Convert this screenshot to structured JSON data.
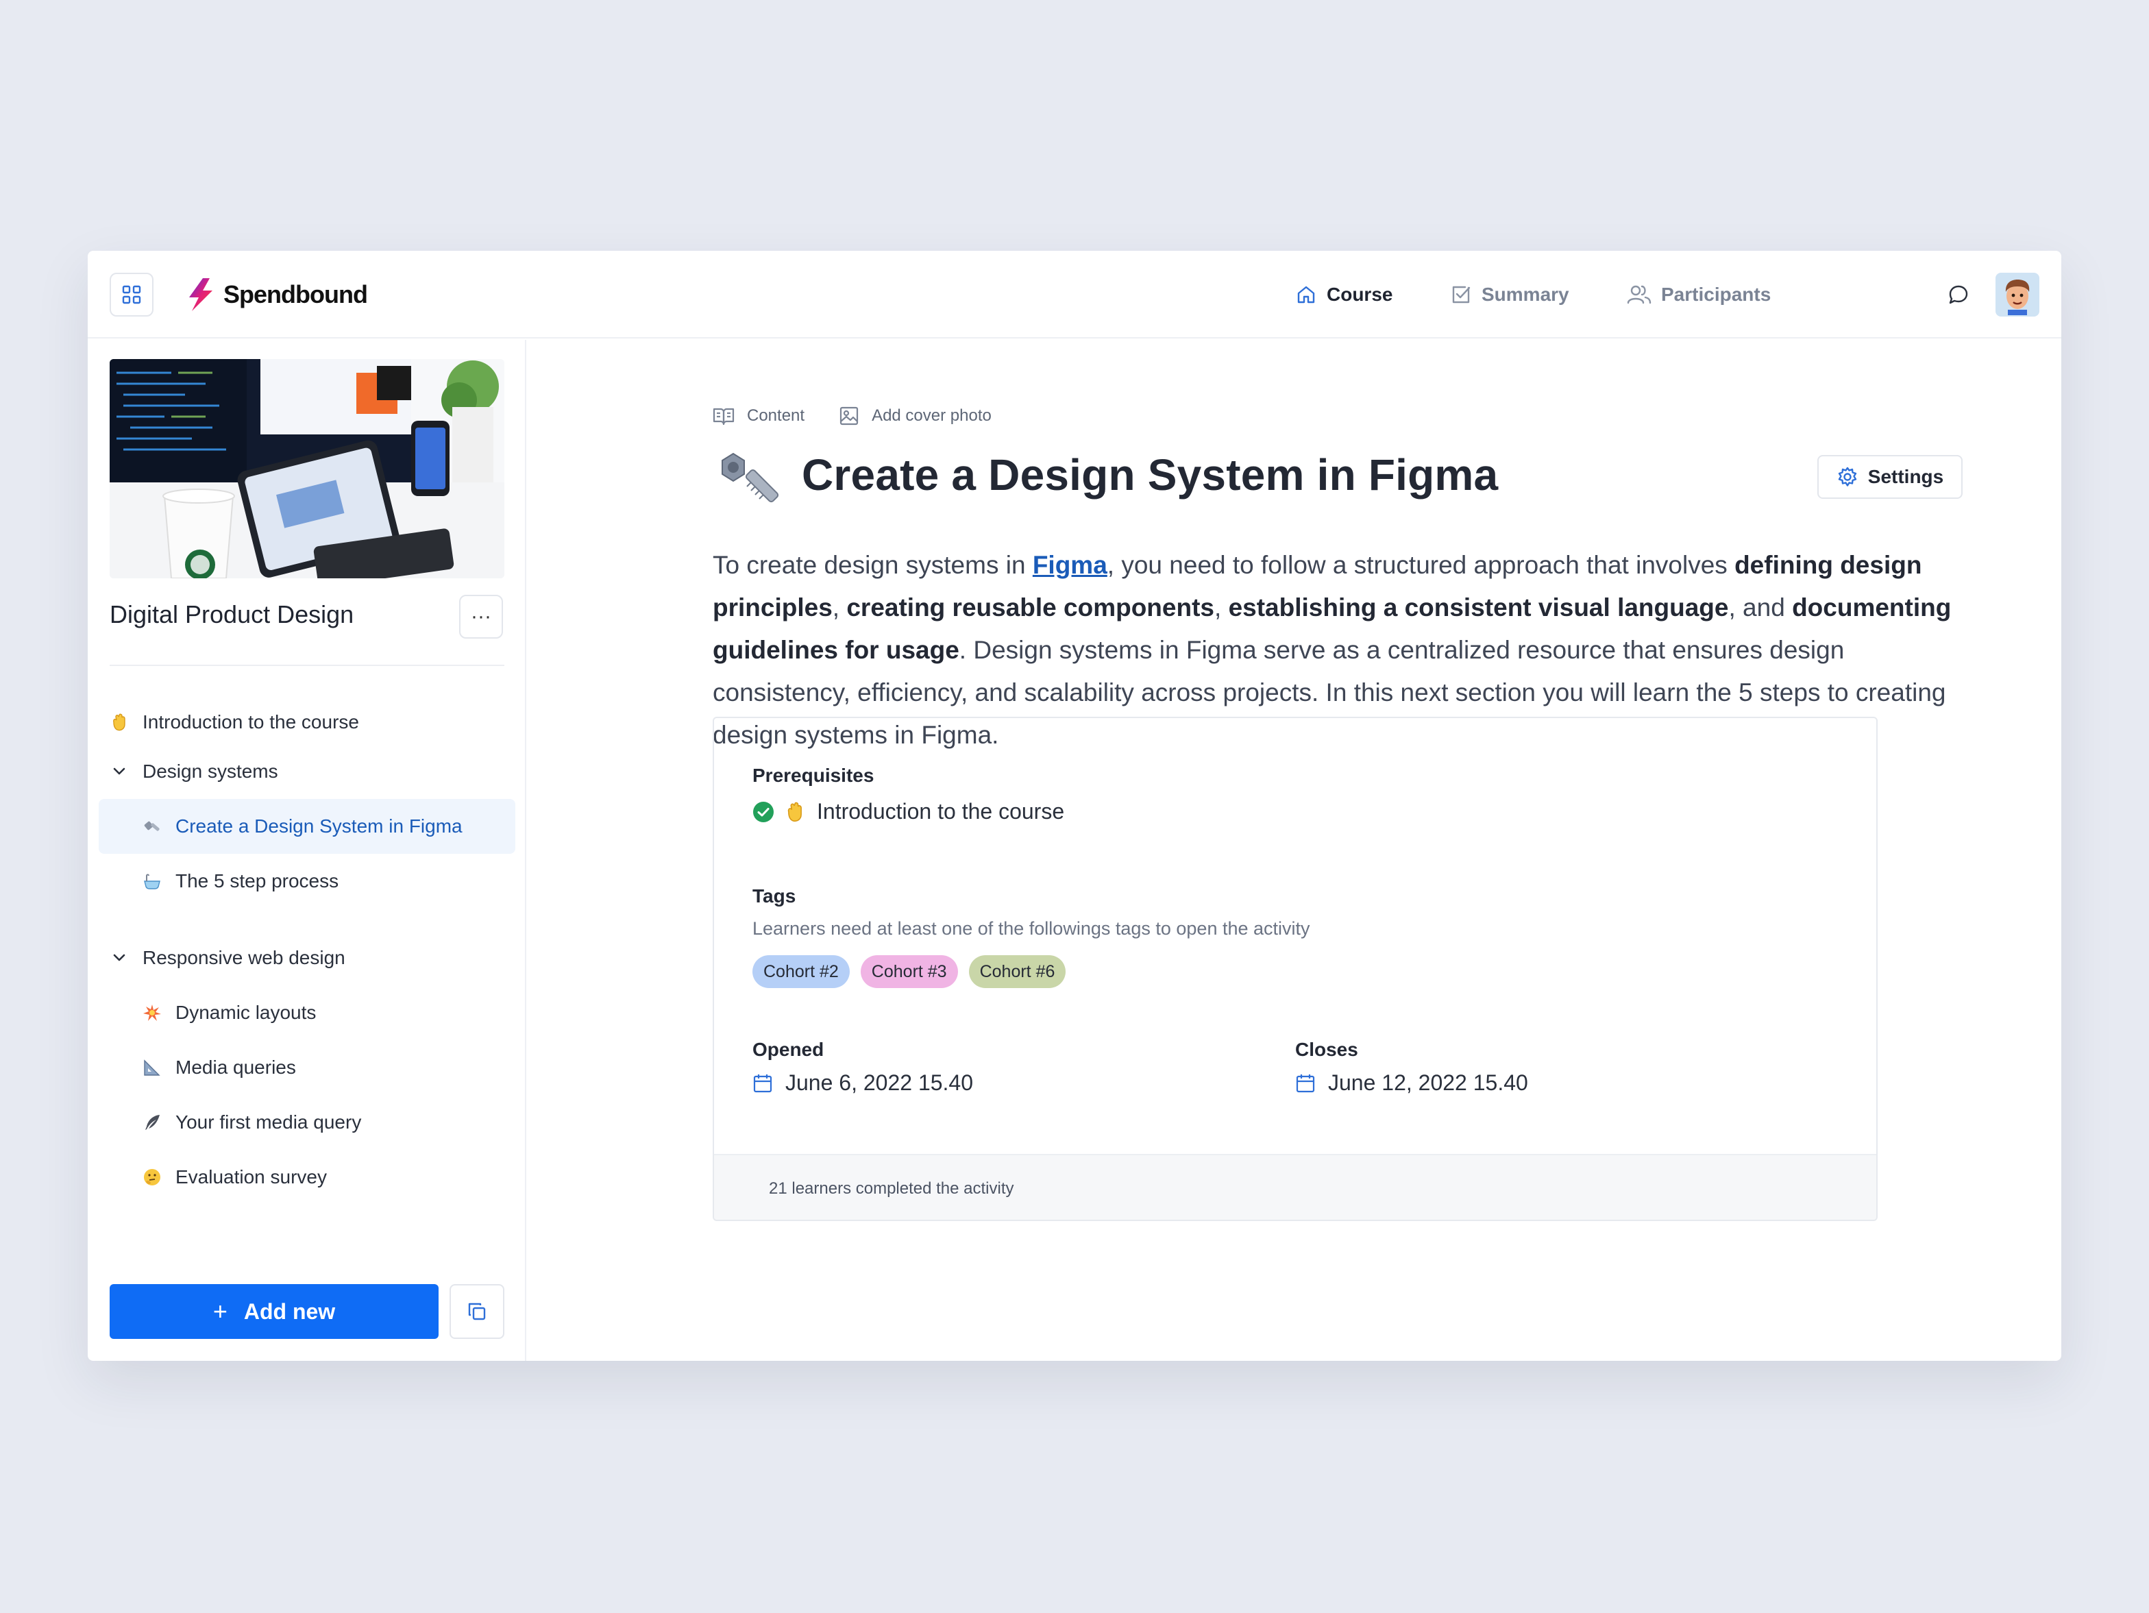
{
  "app": {
    "brand": "Spendbound"
  },
  "nav": {
    "course": "Course",
    "summary": "Summary",
    "participants": "Participants"
  },
  "sidebar": {
    "course_title": "Digital Product Design",
    "more": "···",
    "intro": "Introduction to the course",
    "groups": [
      {
        "title": "Design systems",
        "items": [
          "Create a Design System in Figma",
          "The 5 step process"
        ]
      },
      {
        "title": "Responsive web design",
        "items": [
          "Dynamic layouts",
          "Media queries",
          "Your first media query",
          "Evaluation survey"
        ]
      }
    ],
    "add_new": "Add new"
  },
  "main": {
    "crumb_content": "Content",
    "crumb_cover": "Add cover photo",
    "title": "Create a Design System in Figma",
    "settings": "Settings",
    "desc": {
      "p1": "To create design systems in ",
      "link": "Figma",
      "p2": ", you need to follow a structured approach that involves ",
      "b1": "defining design principles",
      "p3": ", ",
      "b2": "creating reusable components",
      "p4": ", ",
      "b3": "establishing a consistent visual language",
      "p5": ", and ",
      "b4": "documenting guidelines for usage",
      "p6": ". Design systems in Figma serve as a centralized resource that ensures design consistency, efficiency, and scalability across projects. In this next section you will learn the 5 steps to creating design systems in Figma."
    },
    "card": {
      "prereq_label": "Prerequisites",
      "prereq_item": "Introduction to the course",
      "tags_label": "Tags",
      "tags_hint": "Learners need at least one of the followings tags to open the activity",
      "tags": [
        {
          "label": "Cohort #2",
          "color": "#b5cff7"
        },
        {
          "label": "Cohort #3",
          "color": "#f0b4e4"
        },
        {
          "label": "Cohort #6",
          "color": "#c9d6a8"
        }
      ],
      "opened_label": "Opened",
      "opened_value": "June 6, 2022 15.40",
      "closes_label": "Closes",
      "closes_value": "June 12, 2022 15.40",
      "footer": "21 learners completed the activity"
    }
  },
  "colors": {
    "accent": "#0f6cf5",
    "link": "#1a5bb8",
    "success": "#22a05a"
  }
}
